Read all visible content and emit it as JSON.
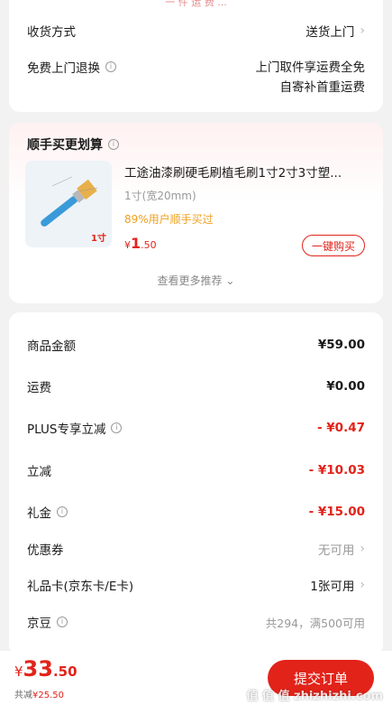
{
  "top": {
    "partial_text": "一 件 运 费 ...",
    "delivery_label": "收货方式",
    "delivery_value": "送货上门",
    "return_label": "免费上门退换",
    "return_value_line1": "上门取件享运费全免",
    "return_value_line2": "自寄补首重运费"
  },
  "recommend": {
    "title": "顺手买更划算",
    "product_name": "工途油漆刷硬毛刷植毛刷1寸2寸3寸塑...",
    "spec": "1寸(宽20mm)",
    "promo": "89%用户顺手买过",
    "price_symbol": "¥",
    "price_int": "1",
    "price_dec": ".50",
    "buy_label": "一键购买",
    "thumb_tag": "1寸",
    "more_label": "查看更多推荐"
  },
  "summary": {
    "rows": [
      {
        "label": "商品金额",
        "value": "¥59.00"
      },
      {
        "label": "运费",
        "value": "¥0.00"
      },
      {
        "label": "PLUS专享立减",
        "value": "- ¥0.47"
      },
      {
        "label": "立减",
        "value": "- ¥10.03"
      },
      {
        "label": "礼金",
        "value": "- ¥15.00"
      },
      {
        "label": "优惠券",
        "value": "无可用"
      },
      {
        "label": "礼品卡(京东卡/E卡)",
        "value": "1张可用"
      },
      {
        "label": "京豆",
        "value": "共294，满500可用"
      }
    ]
  },
  "footer": {
    "total_symbol": "¥",
    "total_int": "33",
    "total_dec": ".50",
    "saved_label": "共减",
    "saved_value": "¥25.50",
    "submit_label": "提交订单",
    "watermark": "值 值 值 zhizhizhi.com"
  },
  "colors": {
    "accent": "#e2231a",
    "promo": "#f0a020"
  }
}
